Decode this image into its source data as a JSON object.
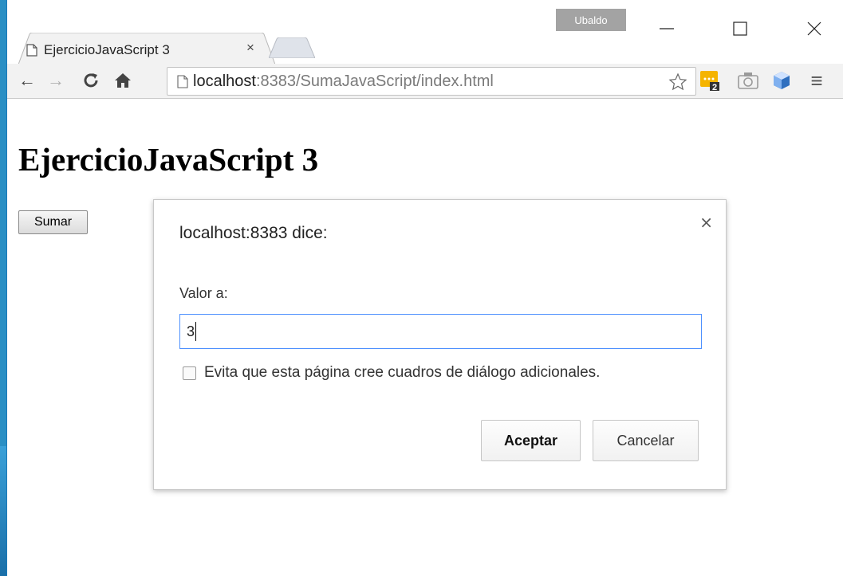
{
  "browser": {
    "profile_name": "Ubaldo",
    "tab": {
      "title": "EjercicioJavaScript 3",
      "close_glyph": "×"
    },
    "window_controls": {
      "minimize": "—",
      "maximize": "☐",
      "close": "✕"
    },
    "toolbar": {
      "back": "←",
      "forward": "→",
      "reload": "C",
      "home": "⌂",
      "url_host": "localhost",
      "url_path": ":8383/SumaJavaScript/index.html",
      "menu": "≡"
    },
    "extensions": {
      "badge_count": "2"
    }
  },
  "page": {
    "heading": "EjercicioJavaScript 3",
    "sum_button_label": "Sumar"
  },
  "dialog": {
    "title": "localhost:8383 dice:",
    "close_glyph": "×",
    "prompt_label": "Valor a:",
    "input_value": "3",
    "checkbox_label": "Evita que esta página cree cuadros de diálogo adicionales.",
    "checkbox_checked": false,
    "ok_label": "Aceptar",
    "cancel_label": "Cancelar"
  },
  "colors": {
    "focus_border": "#4d90fe",
    "desktop": "#2a8fc4"
  }
}
